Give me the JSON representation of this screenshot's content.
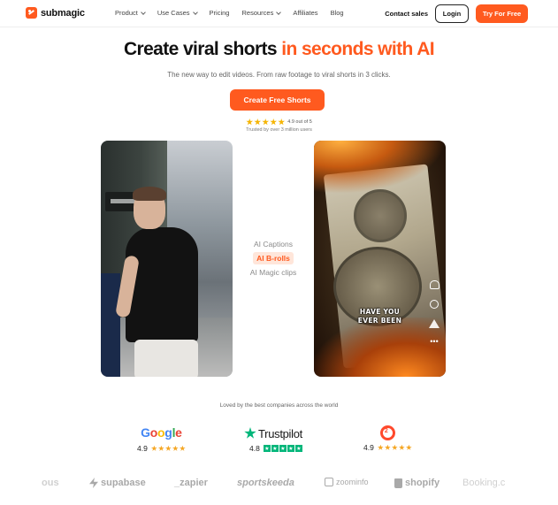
{
  "brand": {
    "name": "submagic",
    "accent": "#ff5a1f"
  },
  "nav": {
    "menu": [
      {
        "label": "Product",
        "has_dropdown": true
      },
      {
        "label": "Use Cases",
        "has_dropdown": true
      },
      {
        "label": "Pricing",
        "has_dropdown": false
      },
      {
        "label": "Resources",
        "has_dropdown": true
      },
      {
        "label": "Affiliates",
        "has_dropdown": false
      },
      {
        "label": "Blog",
        "has_dropdown": false
      }
    ],
    "contact_label": "Contact sales",
    "login_label": "Login",
    "try_label": "Try For Free"
  },
  "hero": {
    "title_plain": "Create viral shorts",
    "title_accent": "in seconds with AI",
    "subtitle": "The new way to edit videos. From raw footage to viral shorts in 3 clicks.",
    "cta_label": "Create Free Shorts",
    "rating_stars": 5,
    "rating_text": "4.9 out of 5",
    "trusted_text": "Trusted by over 3 million users"
  },
  "videos": {
    "right_caption_line1": "HAVE YOU",
    "right_caption_line2": "EVER BEEN",
    "right_icons": [
      "heart-icon",
      "comment-icon",
      "share-icon",
      "more-icon"
    ]
  },
  "features": [
    {
      "label": "AI Captions",
      "active": false
    },
    {
      "label": "AI B-rolls",
      "active": true
    },
    {
      "label": "AI Magic clips",
      "active": false
    }
  ],
  "social_proof": {
    "heading": "Loved by the best companies across the world",
    "reviews": [
      {
        "platform": "Google",
        "score": "4.9",
        "stars": 5
      },
      {
        "platform": "Trustpilot",
        "score": "4.8",
        "stars": 5
      },
      {
        "platform": "G2",
        "score": "4.9",
        "stars": 5
      }
    ],
    "companies": [
      "ous",
      "supabase",
      "_zapier",
      "sportskeeda",
      "zoominfo",
      "shopify",
      "Booking.c"
    ]
  }
}
